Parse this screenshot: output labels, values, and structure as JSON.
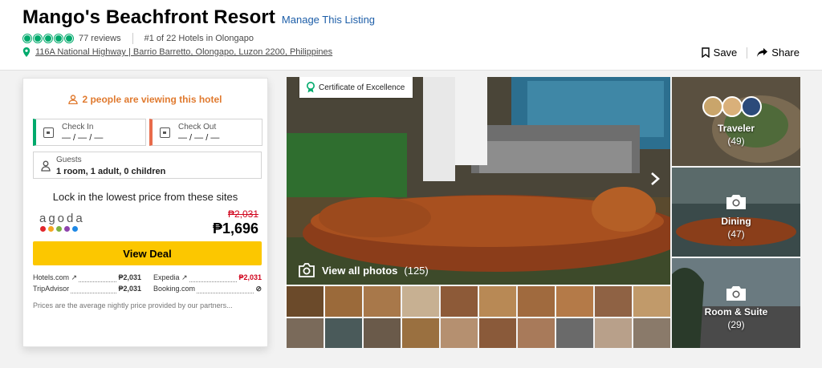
{
  "header": {
    "hotel_name": "Mango's Beachfront Resort",
    "manage_link": "Manage This Listing",
    "rating_bubbles": 5,
    "reviews": "77 reviews",
    "ranking": "#1 of 22 Hotels in Olongapo",
    "address": "116A National Highway | Barrio Barretto, Olongapo, Luzon 2200, Philippines",
    "save_label": "Save",
    "share_label": "Share"
  },
  "booking": {
    "viewing_text": "2 people are viewing this hotel",
    "check_in_label": "Check In",
    "check_in_value": "— / — / —",
    "check_out_label": "Check Out",
    "check_out_value": "— / — / —",
    "guests_label": "Guests",
    "guests_value": "1 room, 1 adult, 0 children",
    "lock_text": "Lock in the lowest price from these sites",
    "provider": "agoda",
    "old_price": "₱2,031",
    "new_price": "₱1,696",
    "view_deal": "View Deal",
    "other_prices": [
      {
        "site": "Hotels.com ↗",
        "price": "₱2,031",
        "red": false
      },
      {
        "site": "Expedia ↗",
        "price": "₱2,031",
        "red": true
      },
      {
        "site": "TripAdvisor",
        "price": "₱2,031",
        "red": false
      },
      {
        "site": "Booking.com",
        "price": "⊘",
        "red": false
      }
    ],
    "note": "Prices are the average nightly price provided by our partners..."
  },
  "photos": {
    "certificate": "Certificate of Excellence",
    "view_all_label": "View all photos",
    "view_all_count": "(125)",
    "categories": [
      {
        "label": "Traveler",
        "count": "(49)"
      },
      {
        "label": "Dining",
        "count": "(47)"
      },
      {
        "label": "Room & Suite",
        "count": "(29)"
      }
    ]
  },
  "colors": {
    "brand_green": "#00aa6c",
    "link_blue": "#1d5ea8",
    "deal_yellow": "#fcc700",
    "alert_orange": "#e07a2f",
    "price_red": "#d0021b"
  }
}
